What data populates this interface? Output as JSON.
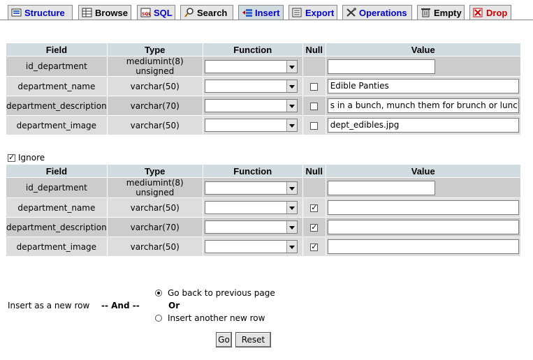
{
  "tabs": [
    {
      "label": "Structure",
      "icon": "structure-icon"
    },
    {
      "label": "Browse",
      "icon": "browse-icon"
    },
    {
      "label": "SQL",
      "icon": "sql-icon"
    },
    {
      "label": "Search",
      "icon": "search-icon"
    },
    {
      "label": "Insert",
      "icon": "insert-icon"
    },
    {
      "label": "Export",
      "icon": "export-icon"
    },
    {
      "label": "Operations",
      "icon": "operations-icon"
    },
    {
      "label": "Empty",
      "icon": "empty-icon"
    },
    {
      "label": "Drop",
      "icon": "drop-icon"
    }
  ],
  "headers": {
    "field": "Field",
    "type": "Type",
    "function": "Function",
    "null": "Null",
    "value": "Value"
  },
  "form1": {
    "rows": [
      {
        "field": "id_department",
        "type": "mediumint(8) unsigned",
        "value": ""
      },
      {
        "field": "department_name",
        "type": "varchar(50)",
        "value": "Edible Panties"
      },
      {
        "field": "department_description",
        "type": "varchar(70)",
        "value": "s in a bunch, munch them for brunch or lunch."
      },
      {
        "field": "department_image",
        "type": "varchar(50)",
        "value": "dept_edibles.jpg"
      }
    ]
  },
  "ignore": {
    "label": "Ignore",
    "checked": true
  },
  "form2": {
    "rows": [
      {
        "field": "id_department",
        "type": "mediumint(8) unsigned",
        "value": ""
      },
      {
        "field": "department_name",
        "type": "varchar(50)",
        "value": ""
      },
      {
        "field": "department_description",
        "type": "varchar(70)",
        "value": ""
      },
      {
        "field": "department_image",
        "type": "varchar(50)",
        "value": ""
      }
    ]
  },
  "footer": {
    "insert_label": "Insert as a new row",
    "and_label": "-- And --",
    "option_back": "Go back to previous page",
    "or_label": "Or",
    "option_another": "Insert another new row",
    "go_label": "Go",
    "reset_label": "Reset"
  }
}
